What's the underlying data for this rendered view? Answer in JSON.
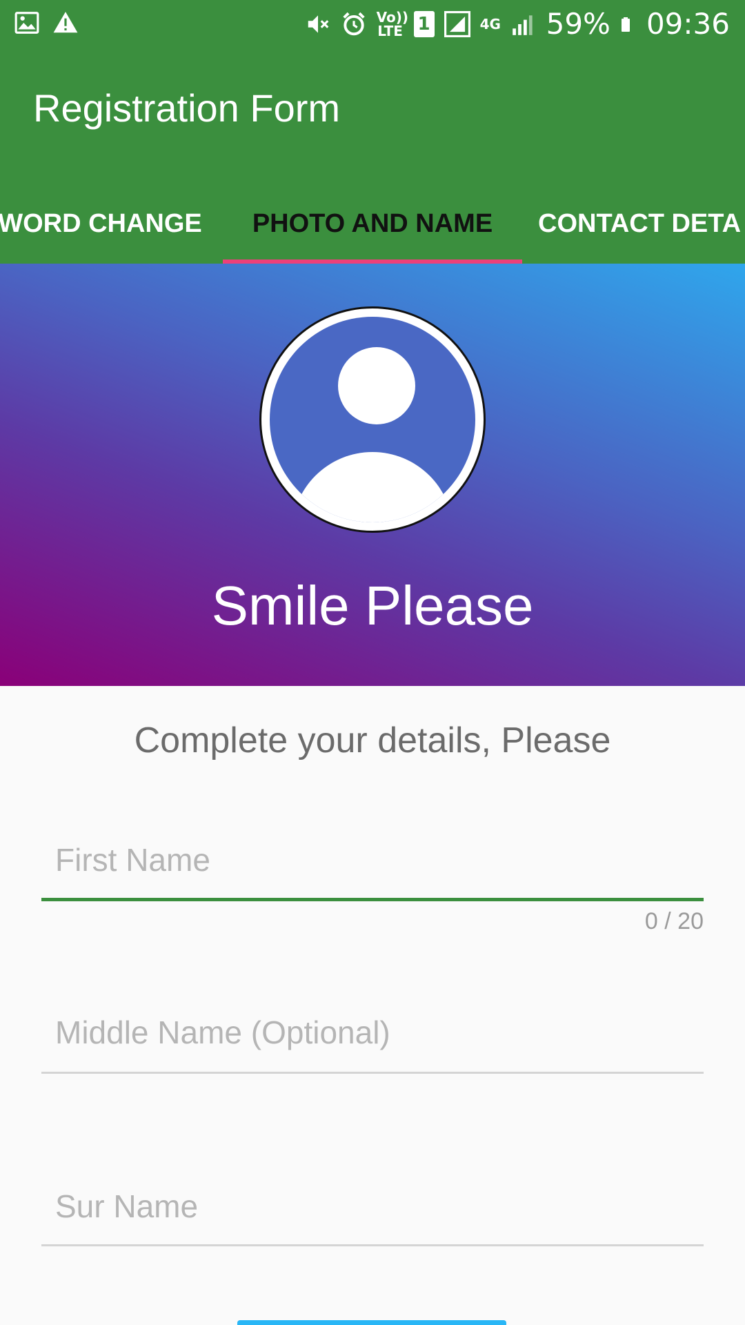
{
  "status_bar": {
    "battery": "59%",
    "time": "09:36",
    "left_icons": [
      "image-icon",
      "warning-icon"
    ],
    "right_icons": [
      "mute-icon",
      "alarm-icon",
      "volte-icon",
      "sim1-icon",
      "signal-icon",
      "4g-icon",
      "signal-icon"
    ],
    "volte_text": "Vo)) LTE",
    "sim_text": "1",
    "network_text": "4G"
  },
  "app_bar": {
    "title": "Registration Form",
    "background": "#3b8f3e"
  },
  "tabs": [
    {
      "label": "WORD CHANGE"
    },
    {
      "label": "PHOTO AND NAME",
      "selected": true
    },
    {
      "label": "CONTACT DETA"
    }
  ],
  "hero": {
    "caption": "Smile Please"
  },
  "form": {
    "subtitle": "Complete your details, Please",
    "first_name": {
      "placeholder": "First Name",
      "value": "",
      "counter": "0 / 20"
    },
    "middle_name": {
      "placeholder": "Middle Name (Optional)",
      "value": ""
    },
    "sur_name": {
      "placeholder": "Sur Name",
      "value": ""
    }
  },
  "colors": {
    "accent": "#3b8f3e",
    "tab_indicator": "#ec407a",
    "button": "#29b6f6"
  }
}
